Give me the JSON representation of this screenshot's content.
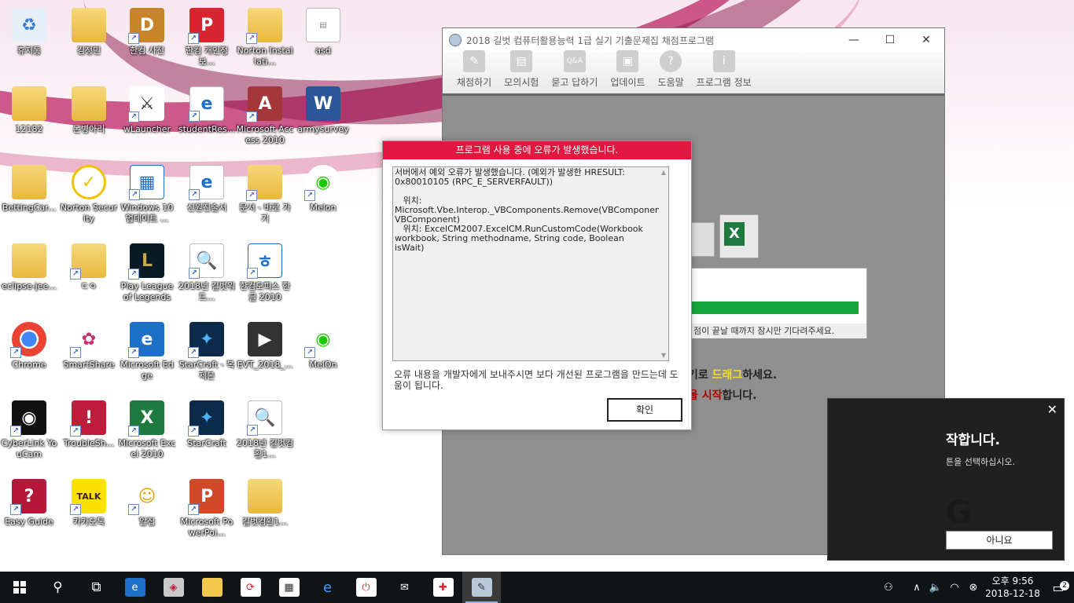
{
  "desktop": {
    "icons": [
      {
        "label": "휴지통"
      },
      {
        "label": "김정민"
      },
      {
        "label": "한컴 사전"
      },
      {
        "label": "한컴 개인정보..."
      },
      {
        "label": "Norton Installati..."
      },
      {
        "label": "asd"
      },
      {
        "label": "12182"
      },
      {
        "label": "논병아리"
      },
      {
        "label": "wLauncher"
      },
      {
        "label": "studentRes..."
      },
      {
        "label": "Microsoft Access 2010"
      },
      {
        "label": "armysurvey"
      },
      {
        "label": "BettingCar..."
      },
      {
        "label": "Norton Security"
      },
      {
        "label": "Windows 10 업데이트 ..."
      },
      {
        "label": "신원진술서"
      },
      {
        "label": "문서 - 바로 가기"
      },
      {
        "label": "Melon"
      },
      {
        "label": "eclipse-jee..."
      },
      {
        "label": "ㄷㅇ"
      },
      {
        "label": "Play League of Legends"
      },
      {
        "label": "2018년 길벗워드..."
      },
      {
        "label": "한컴오피스 한글 2010"
      },
      {
        "label": "Chrome"
      },
      {
        "label": "SmartShare"
      },
      {
        "label": "Microsoft Edge"
      },
      {
        "label": "StarCraft - 복제본"
      },
      {
        "label": "EVT_2018_..."
      },
      {
        "label": "MelOn"
      },
      {
        "label": "CyberLink YouCam"
      },
      {
        "label": "TroubleSh..."
      },
      {
        "label": "Microsoft Excel 2010"
      },
      {
        "label": "StarCraft"
      },
      {
        "label": "2018년 길벗컴활1..."
      },
      {
        "label": "Easy Guide"
      },
      {
        "label": "카카오톡"
      },
      {
        "label": "알집"
      },
      {
        "label": "Microsoft PowerPoi..."
      },
      {
        "label": "길벗컴활1..."
      }
    ]
  },
  "app": {
    "title": "2018 길벗 컴퓨터활용능력 1급 실기 기출문제집 채점프로그램",
    "toolbar": [
      {
        "label": "채점하기"
      },
      {
        "label": "모의시험"
      },
      {
        "label": "묻고 답하기"
      },
      {
        "label": "업데이트"
      },
      {
        "label": "도움말"
      },
      {
        "label": "프로그램 정보"
      }
    ],
    "progress": {
      "text": "점이 끝날 때까지 잠시만 기다려주세요.",
      "value": 1.0
    },
    "hint1_pre": "기로 ",
    "hint1_hl": "드래그",
    "hint1_post": "하세요.",
    "hint2_hl": "을 시작",
    "hint2_post": "합니다."
  },
  "error_dialog": {
    "title": "프로그램 사용 중에 오류가 발생했습니다.",
    "message": "서버에서 예외 오류가 발생했습니다. (예외가 발생한 HRESULT: 0x80010105 (RPC_E_SERVERFAULT))\n\n   위치: Microsoft.Vbe.Interop._VBComponents.Remove(VBComponent VBComponent)\n   위치: ExcelCM2007.ExcelCM.RunCustomCode(Workbook workbook, String methodname, String code, Boolean isWait)",
    "note": "오류 내용을 개발자에게 보내주시면 보다 개선된 프로그램을 만드는데 도움이 됩니다.",
    "ok_label": "확인"
  },
  "toast": {
    "close": "✕",
    "title": "작합니다.",
    "subtitle": "튼을 선택하십시오.",
    "big": "G",
    "no_label": "아니요"
  },
  "taskbar": {
    "start_icon": "windows-icon",
    "time": "오후 9:56",
    "date": "2018-12-18",
    "notification_count": "2"
  },
  "colors": {
    "error_title": "#e0173e",
    "progress": "#16a83c",
    "taskbar": "#101417"
  }
}
